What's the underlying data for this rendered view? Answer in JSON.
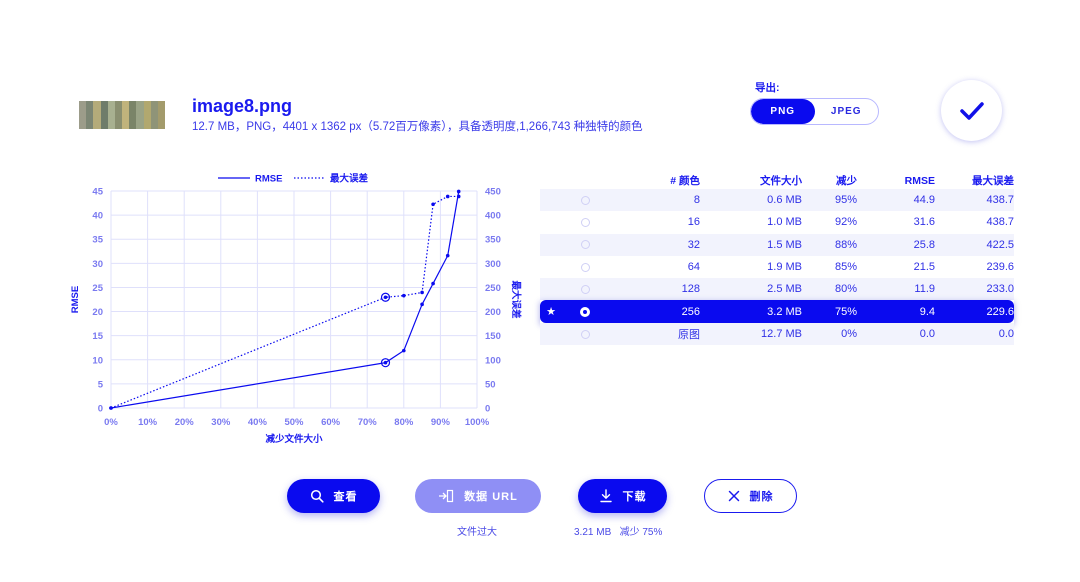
{
  "file": {
    "name": "image8.png",
    "details": "12.7 MB，PNG，4401 x 1362 px（5.72百万像素），具备透明度,1,266,743 种独特的颜色"
  },
  "export": {
    "label": "导出:",
    "options": [
      "PNG",
      "JPEG"
    ],
    "selected": "PNG"
  },
  "chart_data": {
    "type": "line",
    "xlabel": "减少文件大小",
    "ylabel": "RMSE",
    "y2label": "最大误差",
    "x_ticks": [
      "0%",
      "10%",
      "20%",
      "30%",
      "40%",
      "50%",
      "60%",
      "70%",
      "80%",
      "90%",
      "100%"
    ],
    "y_ticks": [
      "0",
      "5",
      "10",
      "15",
      "20",
      "25",
      "30",
      "35",
      "40",
      "45"
    ],
    "y2_ticks": [
      "0",
      "50",
      "100",
      "150",
      "200",
      "250",
      "300",
      "350",
      "400",
      "450"
    ],
    "xlim": [
      0,
      100
    ],
    "ylim": [
      0,
      45
    ],
    "y2lim": [
      0,
      450
    ],
    "grid": true,
    "legend": "top-center",
    "series": [
      {
        "name": "RMSE",
        "style": "solid",
        "axis": "left",
        "x": [
          0,
          75,
          80,
          85,
          88,
          92,
          95
        ],
        "values": [
          0.0,
          9.4,
          11.9,
          21.5,
          25.8,
          31.6,
          44.9
        ]
      },
      {
        "name": "最大误差",
        "style": "dotted",
        "axis": "right",
        "x": [
          0,
          75,
          80,
          85,
          88,
          92,
          95
        ],
        "values": [
          0.0,
          229.6,
          233.0,
          239.6,
          422.5,
          438.7,
          438.7
        ]
      }
    ],
    "highlight_x": 75
  },
  "table": {
    "headers": [
      "# 颜色",
      "文件大小",
      "减少",
      "RMSE",
      "最大误差"
    ],
    "rows": [
      {
        "colors": "8",
        "size": "0.6 MB",
        "reduction": "95%",
        "rmse": "44.9",
        "max": "438.7",
        "selected": false,
        "star": ""
      },
      {
        "colors": "16",
        "size": "1.0 MB",
        "reduction": "92%",
        "rmse": "31.6",
        "max": "438.7",
        "selected": false,
        "star": ""
      },
      {
        "colors": "32",
        "size": "1.5 MB",
        "reduction": "88%",
        "rmse": "25.8",
        "max": "422.5",
        "selected": false,
        "star": ""
      },
      {
        "colors": "64",
        "size": "1.9 MB",
        "reduction": "85%",
        "rmse": "21.5",
        "max": "239.6",
        "selected": false,
        "star": ""
      },
      {
        "colors": "128",
        "size": "2.5 MB",
        "reduction": "80%",
        "rmse": "11.9",
        "max": "233.0",
        "selected": false,
        "star": ""
      },
      {
        "colors": "256",
        "size": "3.2 MB",
        "reduction": "75%",
        "rmse": "9.4",
        "max": "229.6",
        "selected": true,
        "star": "★"
      },
      {
        "colors": "原图",
        "size": "12.7 MB",
        "reduction": "0%",
        "rmse": "0.0",
        "max": "0.0",
        "selected": false,
        "star": ""
      }
    ]
  },
  "actions": {
    "view": "查看",
    "data_url": "数据 URL",
    "download": "下载",
    "delete": "删除",
    "data_url_note": "文件过大",
    "download_note": "3.21 MB   减少 75%"
  },
  "colors": {
    "accent": "#0a0aef",
    "disabled": "#8f8ff5",
    "grid": "#dfe0fb"
  },
  "icons": {
    "view": "search-icon",
    "data_url": "export-icon",
    "download": "download-icon",
    "delete": "close-icon",
    "confirm": "check-icon"
  }
}
